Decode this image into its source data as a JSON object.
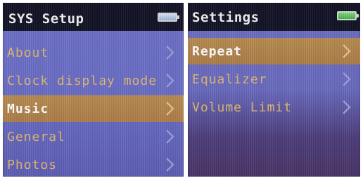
{
  "left_screen": {
    "title": "SYS Setup",
    "battery_icon": "battery-icon",
    "items": [
      {
        "label": "About",
        "selected": false
      },
      {
        "label": "Clock display mode",
        "selected": false
      },
      {
        "label": "Music",
        "selected": true
      },
      {
        "label": "General",
        "selected": false
      },
      {
        "label": "Photos",
        "selected": false
      }
    ]
  },
  "right_screen": {
    "title": "Settings",
    "battery_icon": "battery-icon",
    "items": [
      {
        "label": "Repeat",
        "selected": true
      },
      {
        "label": "Equalizer",
        "selected": false
      },
      {
        "label": "Volume Limit",
        "selected": false
      }
    ]
  },
  "colors": {
    "background": "#6a6ec6",
    "titlebar": "#121326",
    "selection": "#b88c53",
    "item_text": "#e0b870",
    "battery": "#45b34b"
  },
  "icons": {
    "chevron": "chevron-right-icon",
    "battery": "battery-icon"
  }
}
